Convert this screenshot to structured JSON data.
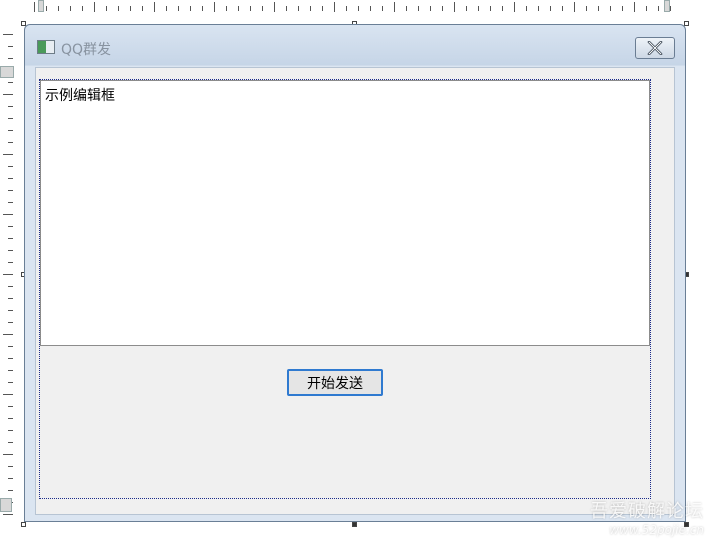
{
  "window": {
    "title": "QQ群发",
    "close_icon": "close-icon"
  },
  "editor": {
    "value": "示例编辑框"
  },
  "actions": {
    "send_label": "开始发送"
  },
  "watermark": {
    "title": "吾爱破解论坛",
    "url": "www.52pojie.cn"
  },
  "colors": {
    "titlebar": "#c6d5e7",
    "client_bg": "#f0f0f0",
    "button_focus_border": "#2f7ad0",
    "selection_outline": "#1b2a8a"
  }
}
